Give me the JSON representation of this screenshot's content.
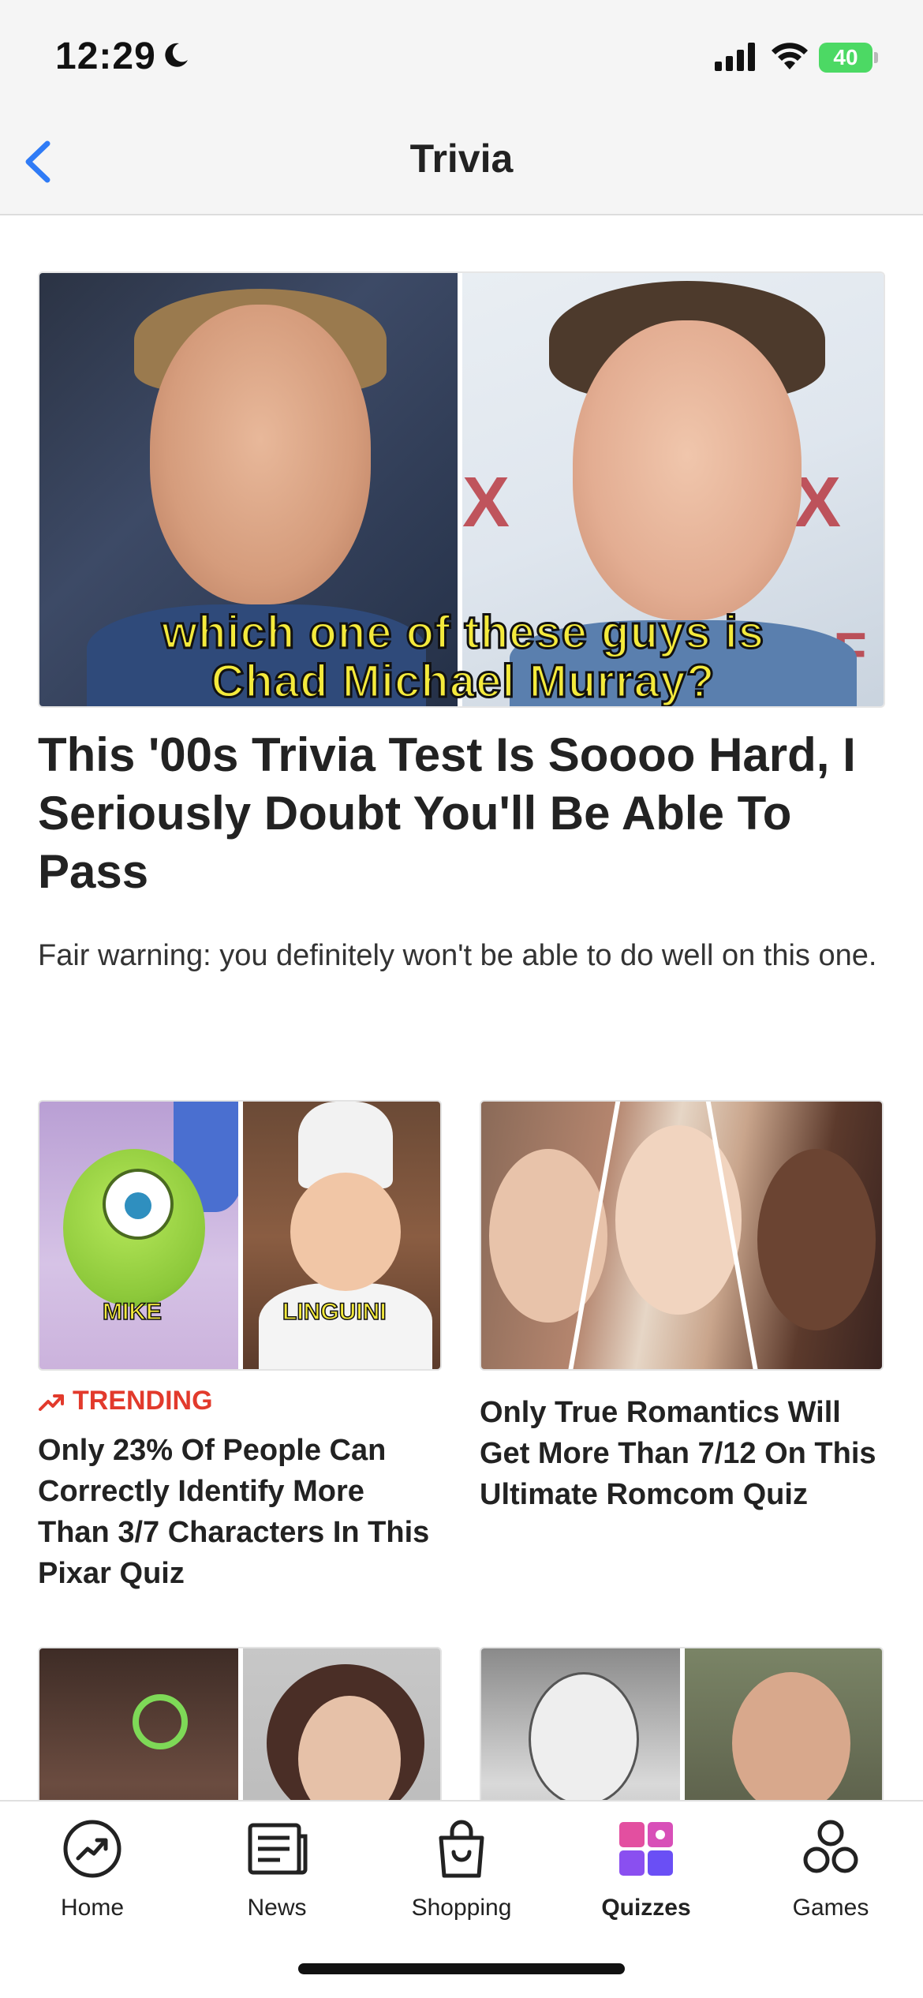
{
  "status_bar": {
    "time": "12:29",
    "battery": "40"
  },
  "nav": {
    "title": "Trivia"
  },
  "hero": {
    "caption_line1": "which one of these guys is",
    "caption_line2": "Chad Michael Murray?",
    "fox_left": "X",
    "fox_right": "X",
    "fox_small": "F",
    "title": "This '00s Trivia Test Is Soooo Hard, I Seriously Doubt You'll Be Able To Pass",
    "description": "Fair warning: you definitely won't be able to do well on this one."
  },
  "cards": [
    {
      "tag_left": "MIKE",
      "tag_right": "LINGUINI",
      "badge": "TRENDING",
      "badge_color": "#e23a2c",
      "title": "Only 23% Of People Can Correctly Identify More Than 3/7 Characters In This Pixar Quiz"
    },
    {
      "title": "Only True Romantics Will Get More Than 7/12 On This Ultimate Romcom Quiz"
    }
  ],
  "tabs": [
    {
      "label": "Home",
      "icon": "home-trending-icon"
    },
    {
      "label": "News",
      "icon": "newspaper-icon"
    },
    {
      "label": "Shopping",
      "icon": "shopping-bag-icon"
    },
    {
      "label": "Quizzes",
      "icon": "quizzes-icon",
      "active": true
    },
    {
      "label": "Games",
      "icon": "games-icon"
    }
  ],
  "colors": {
    "accent_back": "#2f7bf6",
    "quizzes_gradient_start": "#e34fa0",
    "quizzes_gradient_end": "#6a4ff5",
    "caption_yellow": "#f4ea3c"
  }
}
